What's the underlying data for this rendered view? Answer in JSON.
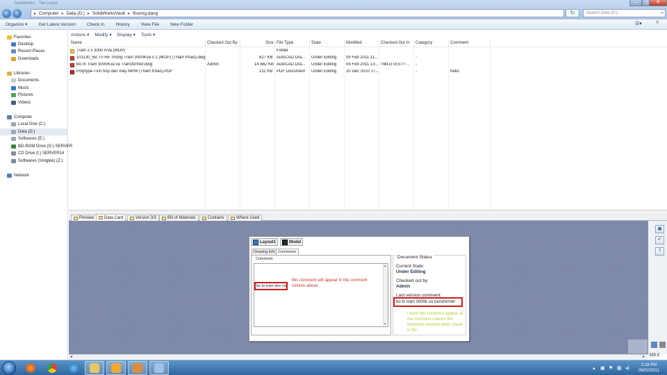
{
  "window": {
    "title_ghost": "SolidWorks  ·  Tab Leave",
    "controls": [
      "–",
      "□",
      "✕"
    ]
  },
  "address": {
    "crumbs": [
      "Computer",
      "Data (D:)",
      "SolidWorksVault",
      "thuong.dang"
    ],
    "search_placeholder": "Search Data (D:)"
  },
  "commandbar": [
    "Organize ▾",
    "Get Latest Version",
    "Check In",
    "History",
    "View File",
    "New Folder"
  ],
  "toolbar2": [
    "Actions ▾",
    "Modify ▾",
    "Display ▾",
    "Tools ▾"
  ],
  "nav": {
    "favorites": "Favorites",
    "fav_items": [
      "Desktop",
      "Recent Places",
      "Downloads"
    ],
    "libraries": "Libraries",
    "lib_items": [
      "Documents",
      "Music",
      "Pictures",
      "Videos"
    ],
    "computer": "Computer",
    "comp_items": [
      "Local Disk (C:)",
      "Data (D:)",
      "Softwares (E:)",
      "BD-ROM Drive (G:) SERVER",
      "CD Drive (I:) SERVER14",
      "Softwares (\\\\mlgtek) (Z:)"
    ],
    "network": "Network"
  },
  "table": {
    "headers": [
      "Name",
      "Checked Out By",
      "Size",
      "File Type",
      "State",
      "Modified",
      "Checked Out In",
      "Category",
      "Comment"
    ],
    "rows": [
      {
        "name": "Tram 2 x 3000 KVa (MOP)",
        "checked_out_by": "",
        "size": "",
        "type": "Folder",
        "state": "",
        "modified": "",
        "checked_out_in": "",
        "category": "",
        "comment": ""
      },
      {
        "name": "101130_Bo Tri He Thong Tram 3000Kva x 2 (MOP) (Tham Khao).dwg",
        "checked_out_by": "",
        "size": "827 KB",
        "type": "AutoCAD Dra...",
        "state": "Under Editing",
        "modified": "09 Feb 2011 11...",
        "checked_out_in": "",
        "category": "-",
        "comment": ""
      },
      {
        "name": "Bo tri Tram 3000Kva va Transformer.dwg",
        "checked_out_by": "Admin",
        "size": "14 882 KB",
        "type": "AutoCAD Dra...",
        "state": "Under Editing",
        "modified": "09 Feb 2011 13...",
        "checked_out_in": "<MLGTEST> ...",
        "category": "-",
        "comment": ""
      },
      {
        "name": "Polytype-Tich hop dan may MPM (Tham Khao).PDF",
        "checked_out_by": "",
        "size": "211 KB",
        "type": "PDF Document",
        "state": "Under Editing",
        "modified": "20 Dec 2010 17...",
        "checked_out_in": "",
        "category": "-",
        "comment": "hello"
      }
    ]
  },
  "tabs": [
    "Preview",
    "Data Card",
    "Version 3/3",
    "Bill of Materials",
    "Contains",
    "Where Used"
  ],
  "card": {
    "tab_layout": "Layout1",
    "tab_model": "Model",
    "subtabs": [
      "Drawing Info",
      "Comments"
    ],
    "comment_label": "Comment:",
    "comment_value": "bo tri tram den nd",
    "annotation_1": "this comment will appear in the comment column above",
    "doc_status_title": "Document Status",
    "current_state_label": "Current State:",
    "current_state_value": "Under Editing",
    "checked_out_label": "Checked out by:",
    "checked_out_value": "Admin",
    "last_comment_label": "Last version comment:",
    "last_comment_value": "bo tri tram 3000k va transformer",
    "annotation_2": "I want this comment appear at the comment column the comment entered when check in file"
  },
  "zoom": "389.8",
  "clock": {
    "time": "2:18 PM",
    "date": "09/02/2011"
  }
}
